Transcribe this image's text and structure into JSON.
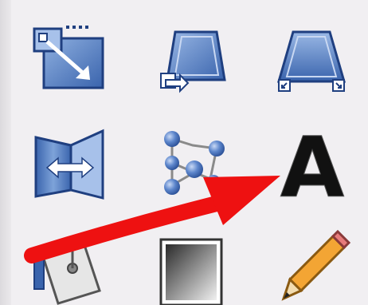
{
  "toolbox": {
    "tools": [
      {
        "id": "scale",
        "icon": "scale-tool-icon"
      },
      {
        "id": "shear",
        "icon": "shear-tool-icon"
      },
      {
        "id": "perspective",
        "icon": "perspective-tool-icon"
      },
      {
        "id": "flip",
        "icon": "flip-tool-icon"
      },
      {
        "id": "cage",
        "icon": "cage-transform-tool-icon"
      },
      {
        "id": "text",
        "icon": "text-tool-icon"
      },
      {
        "id": "bucket-fill",
        "icon": "bucket-fill-tool-icon"
      },
      {
        "id": "blend",
        "icon": "blend-tool-icon"
      },
      {
        "id": "pencil",
        "icon": "pencil-tool-icon"
      }
    ],
    "text_tool_glyph": "A"
  },
  "annotation": {
    "icon": "red-arrow-icon",
    "color": "#ee1111"
  },
  "colors": {
    "background": "#f1eff2",
    "icon_blue": "#3f6cb5",
    "icon_blue_light": "#7ea3d9"
  }
}
